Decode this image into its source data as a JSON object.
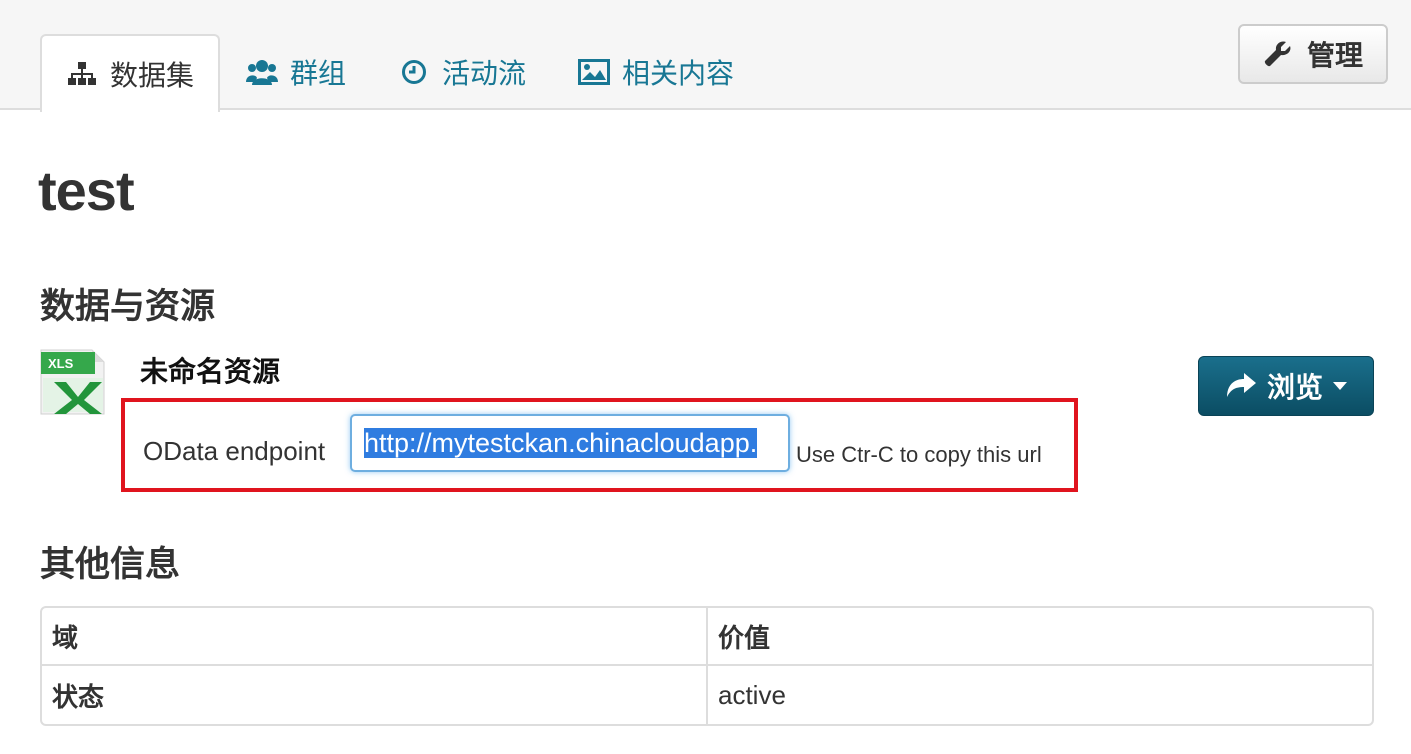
{
  "tabs": [
    {
      "label": "数据集",
      "icon": "sitemap-icon",
      "active": true
    },
    {
      "label": "群组",
      "icon": "users-icon",
      "active": false
    },
    {
      "label": "活动流",
      "icon": "clock-icon",
      "active": false
    },
    {
      "label": "相关内容",
      "icon": "picture-icon",
      "active": false
    }
  ],
  "manage_button": {
    "label": "管理",
    "icon": "wrench-icon"
  },
  "dataset_title": "test",
  "resources": {
    "heading": "数据与资源",
    "item": {
      "name": "未命名资源",
      "icon": "xls-file-icon",
      "icon_text": "XLS",
      "odata_label": "OData endpoint",
      "odata_url": "http://mytestckan.chinacloudapp.",
      "copy_hint": "Use Ctr-C to copy this url"
    },
    "browse_button": {
      "label": "浏览",
      "icon": "share-arrow-icon"
    }
  },
  "additional_info": {
    "heading": "其他信息",
    "columns": [
      "域",
      "价值"
    ],
    "rows": [
      {
        "field": "状态",
        "value": "active"
      }
    ]
  },
  "colors": {
    "link": "#187794",
    "highlight_border": "#e0141e",
    "primary_button": "#0b4d63",
    "selection": "#2f7ce0"
  }
}
